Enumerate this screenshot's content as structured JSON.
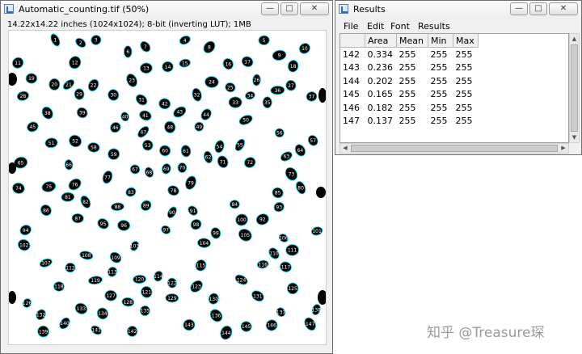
{
  "image_window": {
    "title": "Automatic_counting.tif (50%)",
    "info": "14.22x14.22 inches (1024x1024); 8-bit (inverting LUT); 1MB",
    "controls": {
      "minimize": "—",
      "maximize": "□",
      "close": "✕"
    },
    "particle_labels": [
      "1",
      "2",
      "3",
      "4",
      "5",
      "6",
      "7",
      "8",
      "9",
      "10",
      "11",
      "12",
      "13",
      "14",
      "15",
      "16",
      "17",
      "18",
      "19",
      "20",
      "21",
      "22",
      "23",
      "24",
      "25",
      "26",
      "27",
      "28",
      "29",
      "30",
      "31",
      "32",
      "33",
      "34",
      "35",
      "36",
      "37",
      "38",
      "39",
      "40",
      "41",
      "42",
      "43",
      "44",
      "45",
      "46",
      "47",
      "48",
      "49",
      "50",
      "51",
      "52",
      "53",
      "54",
      "55",
      "56",
      "57",
      "58",
      "59",
      "60",
      "61",
      "62",
      "63",
      "64",
      "65",
      "66",
      "67",
      "68",
      "69",
      "70",
      "71",
      "72",
      "73",
      "74",
      "75",
      "76",
      "77",
      "78",
      "79",
      "80",
      "81",
      "82",
      "83",
      "84",
      "85",
      "86",
      "87",
      "88",
      "89",
      "90",
      "91",
      "92",
      "93",
      "94",
      "95",
      "96",
      "97",
      "98",
      "99",
      "100",
      "101",
      "102",
      "103",
      "104",
      "105",
      "106",
      "107",
      "108",
      "109",
      "110",
      "111",
      "112",
      "113",
      "114",
      "115",
      "116",
      "117",
      "118",
      "119",
      "120",
      "121",
      "122",
      "123",
      "124",
      "125",
      "126",
      "127",
      "128",
      "129",
      "130",
      "131",
      "132",
      "133",
      "134",
      "135",
      "136",
      "137",
      "138",
      "139",
      "140",
      "141",
      "142",
      "143",
      "144",
      "145",
      "146",
      "147"
    ]
  },
  "results_window": {
    "title": "Results",
    "controls": {
      "minimize": "—",
      "maximize": "□",
      "close": "✕"
    },
    "menu": [
      "File",
      "Edit",
      "Font",
      "Results"
    ],
    "columns": [
      "",
      "Area",
      "Mean",
      "Min",
      "Max"
    ],
    "rows": [
      [
        "142",
        "0.334",
        "255",
        "255",
        "255"
      ],
      [
        "143",
        "0.236",
        "255",
        "255",
        "255"
      ],
      [
        "144",
        "0.202",
        "255",
        "255",
        "255"
      ],
      [
        "145",
        "0.165",
        "255",
        "255",
        "255"
      ],
      [
        "146",
        "0.182",
        "255",
        "255",
        "255"
      ],
      [
        "147",
        "0.137",
        "255",
        "255",
        "255"
      ]
    ]
  },
  "watermark": "知乎 @Treasure琛",
  "colors": {
    "outline": "#19c9d6",
    "particle": "#000000",
    "window_bg": "#f0f0f0"
  }
}
